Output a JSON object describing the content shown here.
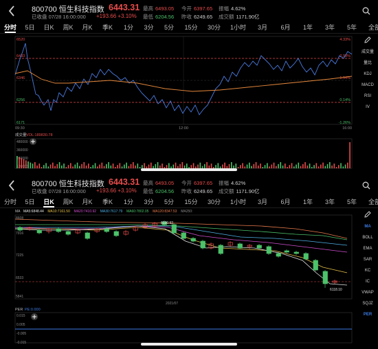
{
  "top": {
    "code": "800700",
    "name": "恒生科技指数",
    "price": "6443.31",
    "status_time": "已收盘 07/28 16:00:000",
    "change_abs": "+193.66",
    "change_pct": "+3.10%",
    "high_label": "最高",
    "high_value": "6493.05",
    "open_label": "今开",
    "open_value": "6397.65",
    "amp_label": "振幅",
    "amp_value": "4.62%",
    "low_label": "最低",
    "low_value": "6204.56",
    "prev_label": "昨收",
    "prev_value": "6249.65",
    "turnover_label": "成交额",
    "turnover_value": "1171.90亿",
    "tabs": [
      "分时",
      "5日",
      "日K",
      "周K",
      "月K",
      "季K",
      "1分",
      "3分",
      "5分",
      "15分",
      "30分",
      "1小时",
      "3月",
      "6月",
      "1年",
      "3年",
      "5年",
      "全部"
    ],
    "active_tab": "分时",
    "side_items": [
      "成交量",
      "量比",
      "KDJ",
      "MACD",
      "RSI",
      "IV"
    ],
    "chart": {
      "y_left": [
        "6520",
        "6433",
        "6346",
        "6256",
        "6171"
      ],
      "y_right": [
        "4.33%",
        "2.93%",
        "1.54%",
        "0.14%",
        "-1.26%"
      ],
      "x_labels": [
        "09:30",
        "12:00",
        "16:00"
      ],
      "vol_title": "成交量",
      "vol_value": "VOL:189830.78",
      "vol_ticks": [
        "480000",
        "360000",
        "240000",
        "120000"
      ]
    }
  },
  "bottom": {
    "code": "800700",
    "name": "恒生科技指数",
    "price": "6443.31",
    "status_time": "已收盘 07/28 16:00:000",
    "change_abs": "+193.66",
    "change_pct": "+3.10%",
    "high_label": "最高",
    "high_value": "6493.05",
    "open_label": "今开",
    "open_value": "6397.65",
    "amp_label": "振幅",
    "amp_value": "4.62%",
    "low_label": "最低",
    "low_value": "6204.56",
    "prev_label": "昨收",
    "prev_value": "6249.65",
    "turnover_label": "成交额",
    "turnover_value": "1171.90亿",
    "tabs": [
      "分时",
      "5日",
      "日K",
      "周K",
      "月K",
      "季K",
      "1分",
      "3分",
      "5分",
      "15分",
      "30分",
      "1小时",
      "3月",
      "6月",
      "1年",
      "3年",
      "5年",
      "全部"
    ],
    "active_tab": "日K",
    "side_items": [
      "MA",
      "BOLL",
      "EMA",
      "SAR",
      "KC",
      "IC",
      "VWAP",
      "SQJZ",
      "PER"
    ],
    "chart": {
      "ma_labels": [
        "MA",
        "MA5:6848.44",
        "MA10:7161.50",
        "MA20:7410.92",
        "MA30:7617.79",
        "MA60:7802.05",
        "MA120:8347.53",
        "MA250:"
      ],
      "ma_colors": [
        "#bdbdbd",
        "#e6e6e6",
        "#e8c24a",
        "#d04fd0",
        "#4fb0e8",
        "#4cc26a",
        "#e87b4c",
        "#8c8c8c"
      ],
      "y_left": [
        "8608",
        "7916",
        "7225",
        "6533",
        "5841"
      ],
      "max_label": "8330.92",
      "min_label": "6118.10",
      "x_label": "2021/07",
      "per_title": "PER",
      "per_value": "PE:0.000",
      "per_ticks": [
        "0.015",
        "0.005",
        "-0.005",
        "-0.015"
      ]
    }
  },
  "colors": {
    "up": "#e84c4c",
    "down": "#4cc26a",
    "accent": "#3d7be3",
    "price_line": "#4a7be0",
    "avg_line": "#e8893c"
  }
}
